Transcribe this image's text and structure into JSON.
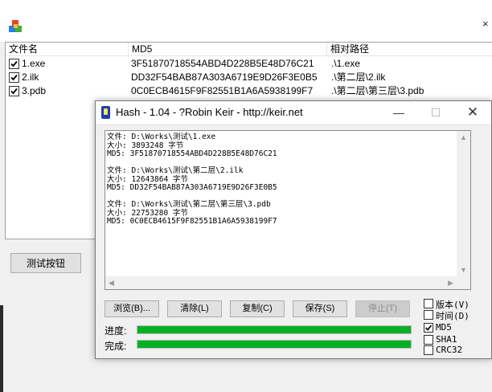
{
  "main_window": {
    "list": {
      "columns": [
        "文件名",
        "MD5",
        "相对路径"
      ],
      "rows": [
        {
          "checked": true,
          "name": "1.exe",
          "md5": "3F51870718554ABD4D228B5E48D76C21",
          "path": ".\\1.exe"
        },
        {
          "checked": true,
          "name": "2.ilk",
          "md5": "DD32F54BAB87A303A6719E9D26F3E0B5",
          "path": ".\\第二层\\2.ilk"
        },
        {
          "checked": true,
          "name": "3.pdb",
          "md5": "0C0ECB4615F9F82551B1A6A5938199F7",
          "path": ".\\第二层\\第三层\\3.pdb"
        }
      ]
    },
    "test_button_label": "测试按钮"
  },
  "hash_window": {
    "title": "Hash - 1.04 - ?Robin Keir - http://keir.net",
    "output_text": "文件: D:\\Works\\测试\\1.exe\n大小: 3893248 字节\nMD5: 3F51870718554ABD4D228B5E48D76C21\n\n文件: D:\\Works\\测试\\第二层\\2.ilk\n大小: 12643864 字节\nMD5: DD32F54BAB87A303A6719E9D26F3E0B5\n\n文件: D:\\Works\\测试\\第二层\\第三层\\3.pdb\n大小: 22753280 字节\nMD5: 0C0ECB4615F9F82551B1A6A5938199F7",
    "buttons": {
      "browse": "浏览(B)...",
      "clear": "清除(L)",
      "copy": "复制(C)",
      "save": "保存(S)",
      "stop": "停止(T)"
    },
    "options": [
      {
        "label": "版本(V)",
        "checked": false
      },
      {
        "label": "时间(D)",
        "checked": false
      },
      {
        "label": "MD5",
        "checked": true
      },
      {
        "label": "SHA1",
        "checked": false
      },
      {
        "label": "CRC32",
        "checked": false
      }
    ],
    "progress_label": "进度:",
    "complete_label": "完成:",
    "progress_fraction": 1.0,
    "complete_fraction": 1.0,
    "accent_color": "#06b025"
  },
  "icons": {
    "app": "colored-boxes-icon",
    "hash": "hash-app-icon",
    "minimize": "minimize-icon",
    "maximize": "maximize-icon",
    "close": "close-icon"
  }
}
